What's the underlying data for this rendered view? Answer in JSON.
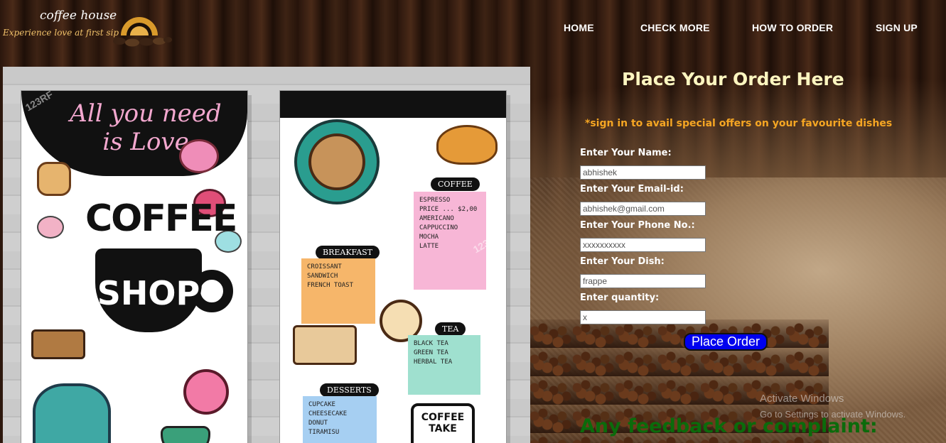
{
  "brand": {
    "name": "coffee house",
    "tagline": "Experience love at first sip"
  },
  "nav": {
    "items": [
      "HOME",
      "CHECK MORE",
      "HOW TO ORDER",
      "SIGN UP"
    ]
  },
  "menu_image": {
    "left_card": {
      "title": "All you need is Love",
      "headline_top": "COFFEE",
      "headline_cup": "SHOP"
    },
    "right_card": {
      "coffee": {
        "title": "COFFEE",
        "items": [
          "ESPRESSO",
          "AMERICANO",
          "CAPPUCCINO",
          "MOCHA",
          "LATTE"
        ]
      },
      "breakfast": {
        "title": "BREAKFAST",
        "items": [
          "CROISSANT",
          "SANDWICH",
          "FRENCH TOAST"
        ]
      },
      "tea": {
        "title": "TEA",
        "items": [
          "BLACK TEA",
          "GREEN TEA",
          "HERBAL TEA"
        ]
      },
      "desserts": {
        "title": "DESSERTS",
        "items": [
          "CUPCAKE",
          "CHEESECAKE",
          "DONUT",
          "TIRAMISU"
        ]
      },
      "price": "PRICE ... $2,00",
      "take_away_badge": "COFFEE TAKE"
    },
    "watermark": "123RF"
  },
  "order": {
    "title": "Place Your Order Here",
    "note": "*sign in to avail special offers on your favourite dishes",
    "fields": [
      {
        "label": "Enter Your Name:",
        "value": "abhishek"
      },
      {
        "label": "Enter Your Email-id:",
        "value": "abhishek@gmail.com"
      },
      {
        "label": "Enter Your Phone No.:",
        "value": "xxxxxxxxxx"
      },
      {
        "label": "Enter Your Dish:",
        "value": "frappe"
      },
      {
        "label": "Enter quantity:",
        "value": "x"
      }
    ],
    "submit_label": "Place Order"
  },
  "feedback": {
    "heading": "Any feedback or complaint:"
  },
  "os_overlay": {
    "line1": "Activate Windows",
    "line2": "Go to Settings to activate Windows."
  },
  "colors": {
    "title": "#fdf6c0",
    "note": "#f5a623",
    "button": "#0000ee",
    "feedback": "#0b6b0b"
  }
}
